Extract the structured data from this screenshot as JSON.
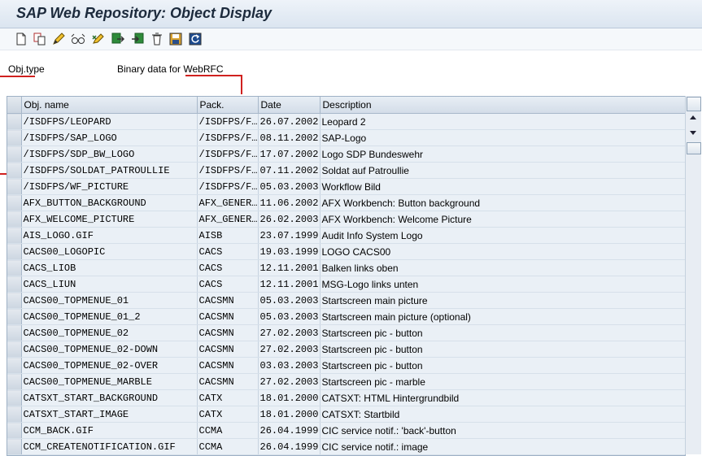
{
  "window": {
    "title": "SAP Web Repository: Object Display"
  },
  "toolbar": {
    "buttons": [
      {
        "name": "create-icon"
      },
      {
        "name": "copy-icon"
      },
      {
        "name": "pencil-icon"
      },
      {
        "name": "glasses-icon"
      },
      {
        "name": "change-display-icon"
      },
      {
        "name": "import-icon"
      },
      {
        "name": "export-icon"
      },
      {
        "name": "delete-icon"
      },
      {
        "name": "save-icon"
      },
      {
        "name": "refresh-icon"
      }
    ]
  },
  "header": {
    "obj_type_label": "Obj.type",
    "obj_type_value": "Binary data for WebRFC"
  },
  "table": {
    "columns": [
      "Obj. name",
      "Pack.",
      "Date",
      "Description"
    ],
    "rows": [
      [
        "/ISDFPS/LEOPARD",
        "/ISDFPS/F…",
        "26.07.2002",
        "Leopard 2"
      ],
      [
        "/ISDFPS/SAP_LOGO",
        "/ISDFPS/F…",
        "08.11.2002",
        "SAP-Logo"
      ],
      [
        "/ISDFPS/SDP_BW_LOGO",
        "/ISDFPS/F…",
        "17.07.2002",
        "Logo SDP Bundeswehr"
      ],
      [
        "/ISDFPS/SOLDAT_PATROULLIE",
        "/ISDFPS/F…",
        "07.11.2002",
        "Soldat auf Patroullie"
      ],
      [
        "/ISDFPS/WF_PICTURE",
        "/ISDFPS/F…",
        "05.03.2003",
        "Workflow Bild"
      ],
      [
        "AFX_BUTTON_BACKGROUND",
        "AFX_GENER…",
        "11.06.2002",
        "AFX Workbench: Button background"
      ],
      [
        "AFX_WELCOME_PICTURE",
        "AFX_GENER…",
        "26.02.2003",
        "AFX Workbench: Welcome Picture"
      ],
      [
        "AIS_LOGO.GIF",
        "AISB",
        "23.07.1999",
        "Audit Info System Logo"
      ],
      [
        "CACS00_LOGOPIC",
        "CACS",
        "19.03.1999",
        "LOGO CACS00"
      ],
      [
        "CACS_LIOB",
        "CACS",
        "12.11.2001",
        "Balken links oben"
      ],
      [
        "CACS_LIUN",
        "CACS",
        "12.11.2001",
        "MSG-Logo links unten"
      ],
      [
        "CACS00_TOPMENUE_01",
        "CACSMN",
        "05.03.2003",
        "Startscreen main picture"
      ],
      [
        "CACS00_TOPMENUE_01_2",
        "CACSMN",
        "05.03.2003",
        "Startscreen main picture (optional)"
      ],
      [
        "CACS00_TOPMENUE_02",
        "CACSMN",
        "27.02.2003",
        "Startscreen pic - button"
      ],
      [
        "CACS00_TOPMENUE_02-DOWN",
        "CACSMN",
        "27.02.2003",
        "Startscreen pic - button"
      ],
      [
        "CACS00_TOPMENUE_02-OVER",
        "CACSMN",
        "03.03.2003",
        "Startscreen pic - button"
      ],
      [
        "CACS00_TOPMENUE_MARBLE",
        "CACSMN",
        "27.02.2003",
        "Startscreen pic - marble"
      ],
      [
        "CATSXT_START_BACKGROUND",
        "CATX",
        "18.01.2000",
        "CATSXT: HTML Hintergrundbild"
      ],
      [
        "CATSXT_START_IMAGE",
        "CATX",
        "18.01.2000",
        "CATSXT: Startbild"
      ],
      [
        "CCM_BACK.GIF",
        "CCMA",
        "26.04.1999",
        "CIC service notif.: 'back'-button"
      ],
      [
        "CCM_CREATENOTIFICATION.GIF",
        "CCMA",
        "26.04.1999",
        "CIC service notif.: image"
      ]
    ]
  }
}
